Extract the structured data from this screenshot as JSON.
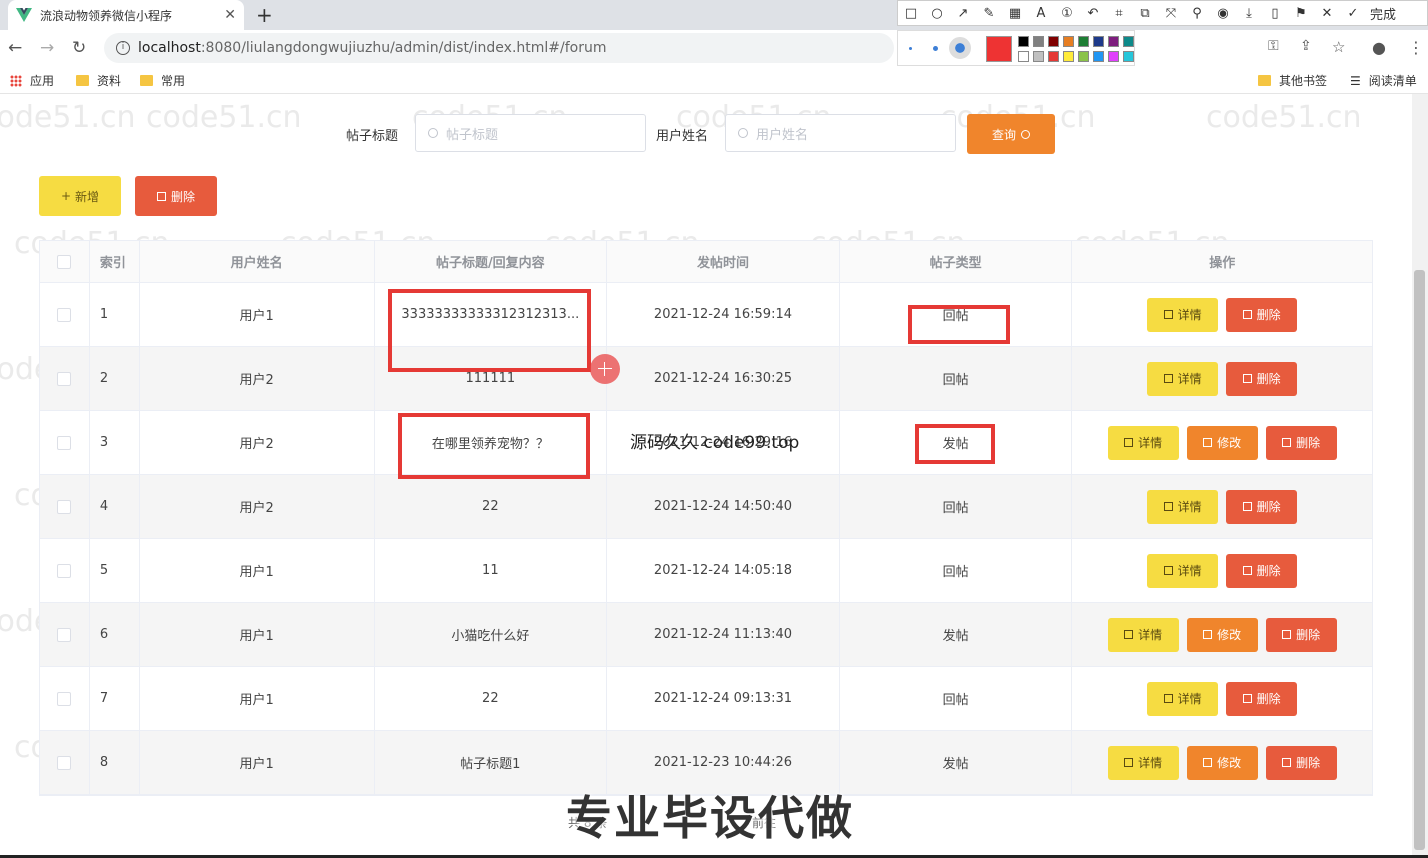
{
  "browser": {
    "tab_title": "流浪动物领养微信小程序",
    "url_host": "localhost",
    "url_rest": ":8080/liulangdongwujiuzhu/admin/dist/index.html#/forum",
    "bookmarks": [
      "应用",
      "资料",
      "常用"
    ],
    "bookmarks_right": [
      "其他书签",
      "阅读清单"
    ],
    "done_label": "完成"
  },
  "search": {
    "title_label": "帖子标题",
    "title_placeholder": "帖子标题",
    "user_label": "用户姓名",
    "user_placeholder": "用户姓名",
    "query_button": "查询"
  },
  "toolbar": {
    "add_label": "新增",
    "delete_label": "删除"
  },
  "table": {
    "headers": [
      "索引",
      "用户姓名",
      "帖子标题/回复内容",
      "发帖时间",
      "帖子类型",
      "操作"
    ],
    "rows": [
      {
        "index": "1",
        "user": "用户1",
        "content": "33333333333312312313...",
        "time": "2021-12-24 16:59:14",
        "type": "回帖",
        "actions": [
          "详情",
          "删除"
        ]
      },
      {
        "index": "2",
        "user": "用户2",
        "content": "111111",
        "time": "2021-12-24 16:30:25",
        "type": "回帖",
        "actions": [
          "详情",
          "删除"
        ]
      },
      {
        "index": "3",
        "user": "用户2",
        "content": "在哪里领养宠物？？",
        "time": "2021-12-24 16:29:16",
        "type": "发帖",
        "actions": [
          "详情",
          "修改",
          "删除"
        ]
      },
      {
        "index": "4",
        "user": "用户2",
        "content": "22",
        "time": "2021-12-24 14:50:40",
        "type": "回帖",
        "actions": [
          "详情",
          "删除"
        ]
      },
      {
        "index": "5",
        "user": "用户1",
        "content": "11",
        "time": "2021-12-24 14:05:18",
        "type": "回帖",
        "actions": [
          "详情",
          "删除"
        ]
      },
      {
        "index": "6",
        "user": "用户1",
        "content": "小猫吃什么好",
        "time": "2021-12-24 11:13:40",
        "type": "发帖",
        "actions": [
          "详情",
          "修改",
          "删除"
        ]
      },
      {
        "index": "7",
        "user": "用户1",
        "content": "22",
        "time": "2021-12-24 09:13:31",
        "type": "回帖",
        "actions": [
          "详情",
          "删除"
        ]
      },
      {
        "index": "8",
        "user": "用户1",
        "content": "帖子标题1",
        "time": "2021-12-23 10:44:26",
        "type": "发帖",
        "actions": [
          "详情",
          "修改",
          "删除"
        ]
      }
    ]
  },
  "overlays": {
    "watermark_text": "code51.cn",
    "source_text": "源码久久 code99.top",
    "caption": "专业毕设代做",
    "pager_left": "共 8 条",
    "pager_right": "前往"
  },
  "colors": {
    "accent_orange": "#f0852c",
    "yellow": "#f6dc42",
    "red": "#e75b3d",
    "annotation_red": "#e53935"
  }
}
